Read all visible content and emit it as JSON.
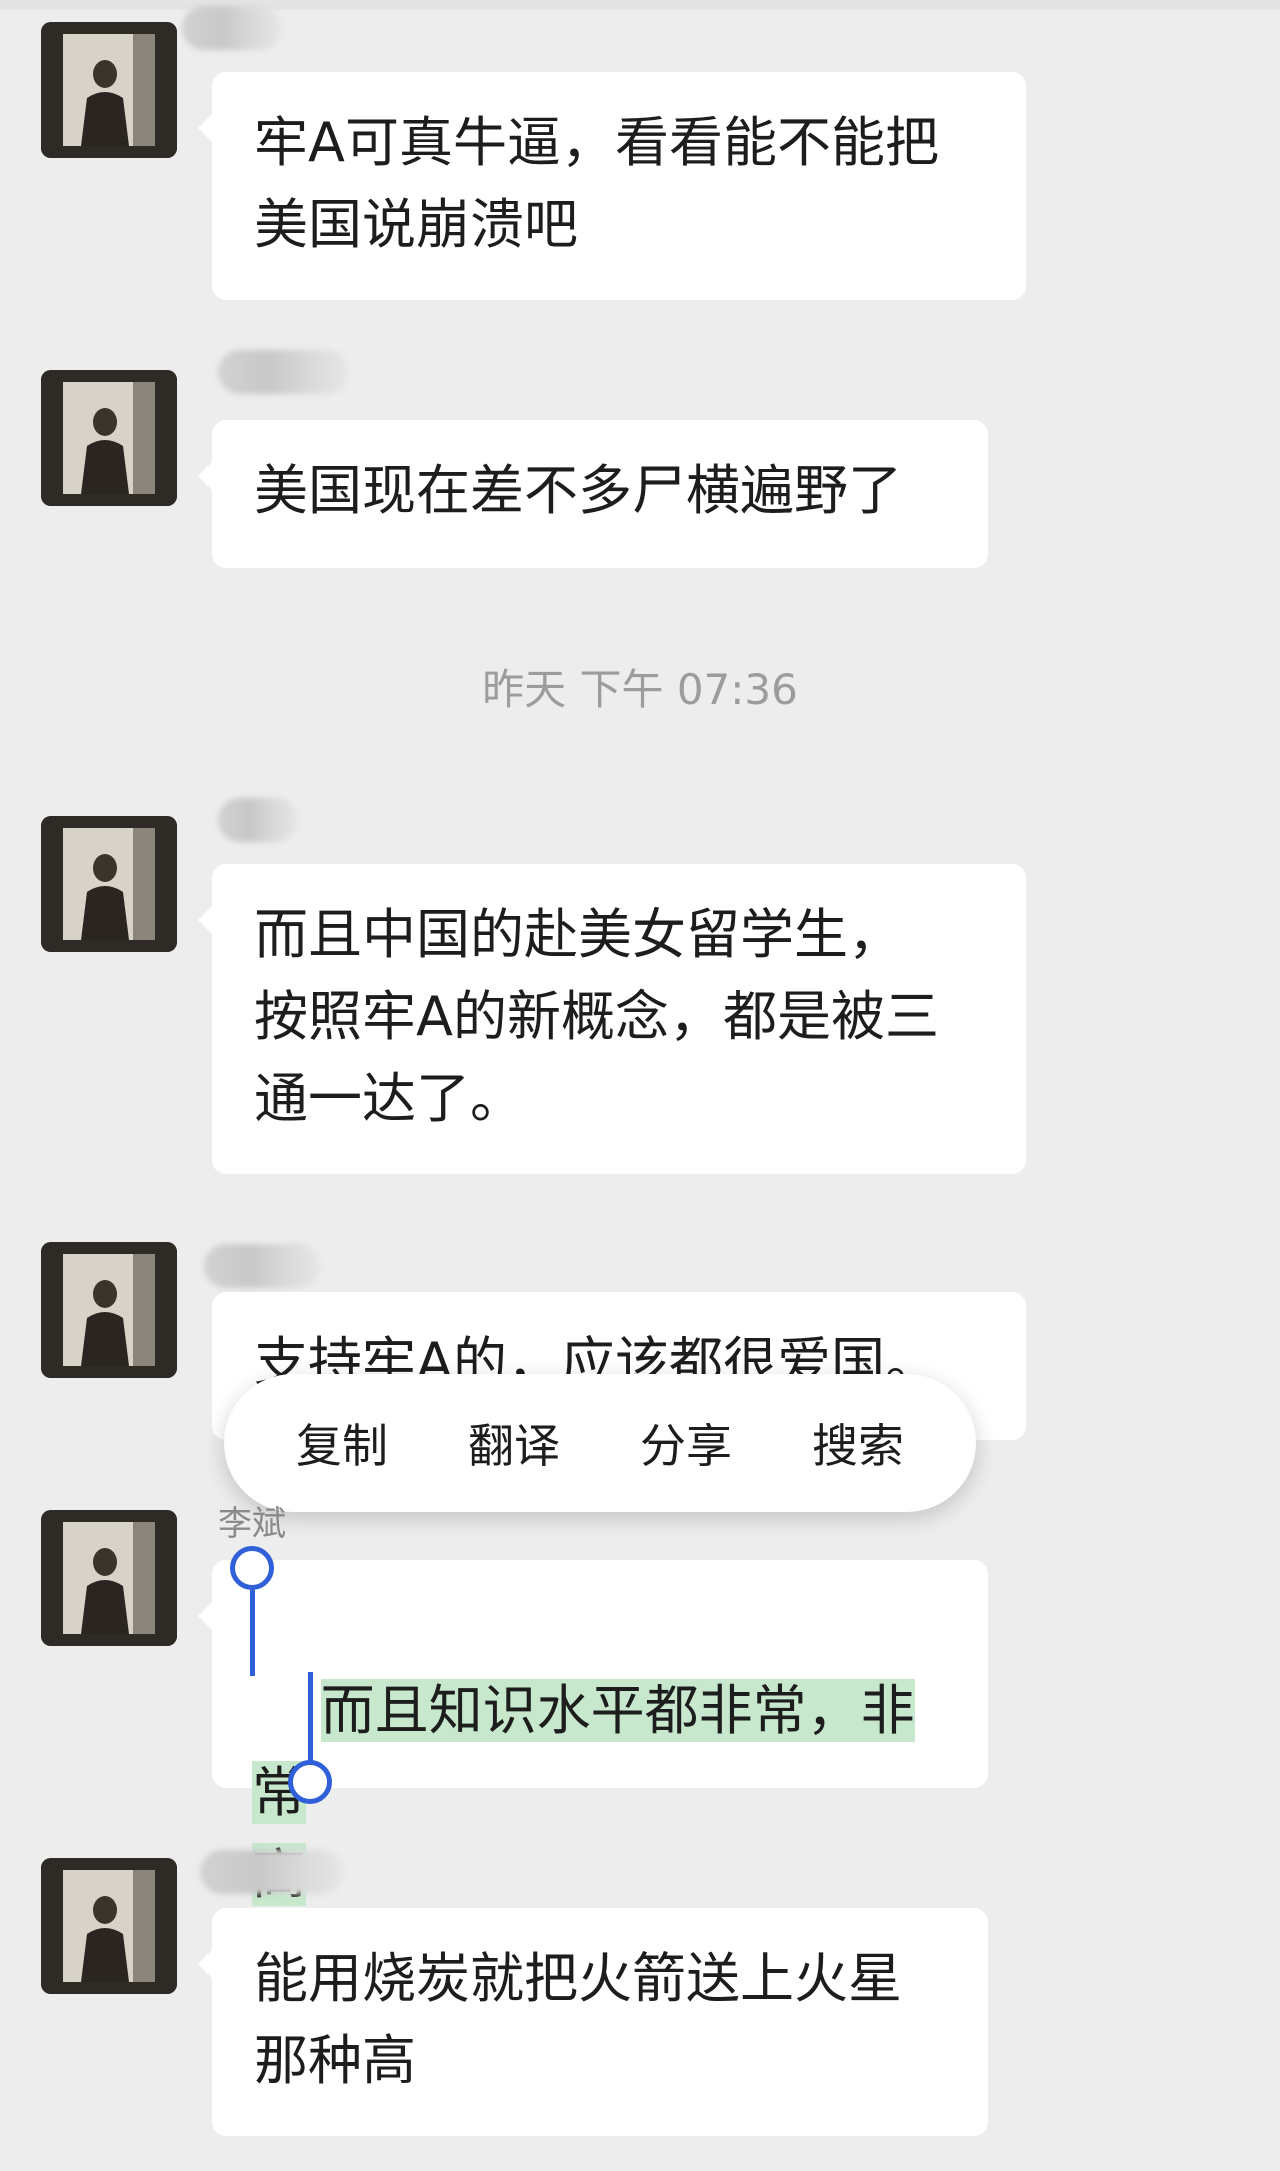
{
  "messages": [
    {
      "sender": "李斌",
      "text": "牢A可真牛逼，看看能不能把\n美国说崩溃吧"
    },
    {
      "sender": "李斌",
      "text": "美国现在差不多尸横遍野了"
    },
    {
      "sender": "李斌",
      "text": "而且中国的赴美女留学生，\n按照牢A的新概念，都是被三\n通一达了。"
    },
    {
      "sender": "李斌",
      "text": "支持牢A的，应该都很爱国。"
    },
    {
      "sender": "李斌",
      "text_line1": "而且知识水平都非常，非常",
      "text_line2": "高"
    },
    {
      "sender": "李斌",
      "text": "能用烧炭就把火箭送上火星\n那种高"
    }
  ],
  "timestamp": "昨天 下午 07:36",
  "context_menu": {
    "copy": "复制",
    "translate": "翻译",
    "share": "分享",
    "search": "搜索"
  },
  "colors": {
    "background": "#ededed",
    "bubble": "#ffffff",
    "selection": "#c7e8cd",
    "handle": "#2f5fd9"
  }
}
